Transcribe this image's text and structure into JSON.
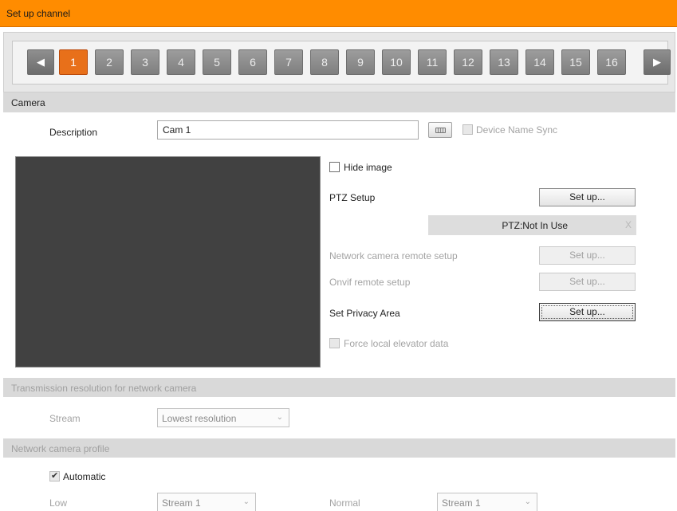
{
  "window": {
    "title": "Set up channel"
  },
  "channel_bar": {
    "prev_icon": "triangle-left-icon",
    "next_icon": "triangle-right-icon",
    "channels": [
      "1",
      "2",
      "3",
      "4",
      "5",
      "6",
      "7",
      "8",
      "9",
      "10",
      "11",
      "12",
      "13",
      "14",
      "15",
      "16"
    ],
    "active_channel": "1",
    "active_color": "#e8701a"
  },
  "camera": {
    "section_title": "Camera",
    "description_label": "Description",
    "description_value": "Cam 1",
    "keyboard_icon": "keyboard-icon",
    "device_name_sync_label": "Device Name Sync",
    "hide_image_label": "Hide image",
    "ptz_setup_label": "PTZ Setup",
    "ptz_setup_button": "Set up...",
    "ptz_status": "PTZ:Not In Use",
    "ptz_clear": "X",
    "network_remote_label": "Network camera remote setup",
    "network_remote_button": "Set up...",
    "onvif_label": "Onvif remote setup",
    "onvif_button": "Set up...",
    "privacy_label": "Set Privacy Area",
    "privacy_button": "Set up...",
    "force_elevator_label": "Force local elevator data"
  },
  "transmission": {
    "section_title": "Transmission resolution for network camera",
    "stream_label": "Stream",
    "stream_value": "Lowest resolution"
  },
  "profile": {
    "section_title": "Network camera profile",
    "automatic_label": "Automatic",
    "low_label": "Low",
    "low_value": "Stream 1",
    "normal_label": "Normal",
    "normal_value": "Stream 1"
  }
}
